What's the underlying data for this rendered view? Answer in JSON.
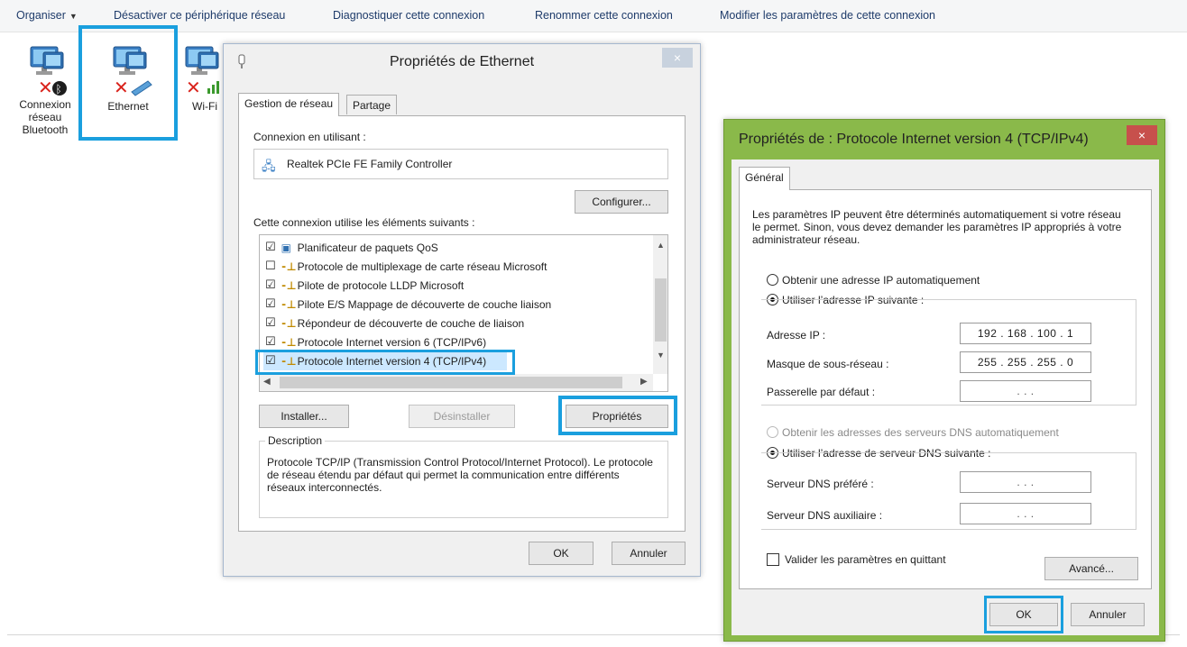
{
  "toolbar": {
    "organise": "Organiser",
    "disable": "Désactiver ce périphérique réseau",
    "diagnose": "Diagnostiquer cette connexion",
    "rename": "Renommer cette connexion",
    "modify": "Modifier les paramètres de cette connexion"
  },
  "adapters": [
    {
      "label": "Connexion réseau Bluetooth"
    },
    {
      "label": "Ethernet"
    },
    {
      "label": "Wi-Fi"
    }
  ],
  "ethernet_dialog": {
    "title": "Propriétés de Ethernet",
    "close": "×",
    "tabs": [
      "Gestion de réseau",
      "Partage"
    ],
    "connect_using_label": "Connexion en utilisant :",
    "adapter_name": "Realtek PCIe FE Family Controller",
    "configure_button": "Configurer...",
    "items_label": "Cette connexion utilise les éléments suivants :",
    "items": [
      {
        "label": "Planificateur de paquets QoS",
        "checked": "☑"
      },
      {
        "label": "Protocole de multiplexage de carte réseau Microsoft",
        "checked": "☐"
      },
      {
        "label": "Pilote de protocole LLDP Microsoft",
        "checked": "☑"
      },
      {
        "label": "Pilote E/S Mappage de découverte de couche liaison",
        "checked": "☑"
      },
      {
        "label": "Répondeur de découverte de couche de liaison",
        "checked": "☑"
      },
      {
        "label": "Protocole Internet version 6 (TCP/IPv6)",
        "checked": "☑"
      },
      {
        "label": "Protocole Internet version 4 (TCP/IPv4)",
        "checked": "☑"
      }
    ],
    "install_button": "Installer...",
    "uninstall_button": "Désinstaller",
    "properties_button": "Propriétés",
    "description_label": "Description",
    "description_text": "Protocole TCP/IP (Transmission Control Protocol/Internet Protocol). Le protocole de réseau étendu par défaut qui permet la communication entre différents réseaux interconnectés.",
    "ok_button": "OK",
    "cancel_button": "Annuler"
  },
  "ipv4_dialog": {
    "title": "Propriétés de : Protocole Internet version 4 (TCP/IPv4)",
    "close": "×",
    "tab": "Général",
    "intro": "Les paramètres IP peuvent être déterminés automatiquement si votre réseau le permet. Sinon, vous devez demander les paramètres IP appropriés à votre administrateur réseau.",
    "auto_ip": "Obtenir une adresse IP automatiquement",
    "manual_ip": "Utiliser l’adresse IP suivante :",
    "ip_label": "Adresse IP :",
    "ip_value": "192 . 168 . 100 .  1",
    "mask_label": "Masque de sous-réseau :",
    "mask_value": "255 . 255 . 255 .  0",
    "gateway_label": "Passerelle par défaut :",
    "gateway_value": ".       .       .",
    "auto_dns": "Obtenir les adresses des serveurs DNS automatiquement",
    "manual_dns": "Utiliser l’adresse de serveur DNS suivante :",
    "dns_pref_label": "Serveur DNS préféré :",
    "dns_pref_value": ".       .       .",
    "dns_alt_label": "Serveur DNS auxiliaire :",
    "dns_alt_value": ".       .       .",
    "validate_label": "Valider les paramètres en quittant",
    "advanced_button": "Avancé...",
    "ok_button": "OK",
    "cancel_button": "Annuler"
  },
  "colors": {
    "highlight": "#1a9fde",
    "ipv4_frame": "#8ab94a",
    "close_red": "#c7504c"
  }
}
